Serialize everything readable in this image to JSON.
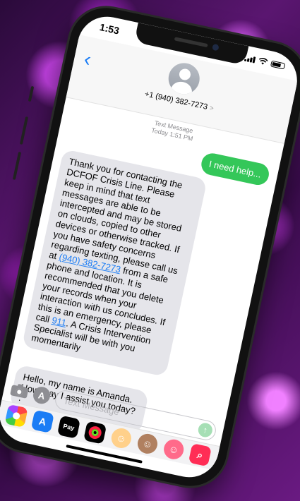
{
  "status_bar": {
    "time": "1:53"
  },
  "header": {
    "contact": "+1 (940) 382-7273",
    "chevron": ">"
  },
  "thread": {
    "label_line1": "Text Message",
    "label_line2": "Today 1:51 PM"
  },
  "messages": {
    "sent_1": "I need help...",
    "received_1": {
      "part1": "Thank you for contacting the DCFOF Crisis Line. Please keep in mind that text messages are able to be intercepted and may be stored on clouds, copied to other devices or otherwise tracked. If you have safety concerns regarding texting, please call us at ",
      "phone_link": "(940) 382-7273",
      "part2": " from a safe phone and location. It is recommended that you delete your records when your interaction with us concludes. If this is an emergency, please call ",
      "emergency_link": "911",
      "part3": ". A Crisis Intervention Specialist will be with you momentarily"
    },
    "received_2": "Hello, my name is Amanda. How may I assist you today?",
    "received_2_trailing": "."
  },
  "input": {
    "placeholder": "Text Message",
    "send_glyph": "↑",
    "appstore_glyph": "A"
  },
  "app_drawer": {
    "applepay_label": "Pay",
    "appstore_glyph": "A"
  },
  "colors": {
    "sent_bubble": "#34c759",
    "received_bubble": "#e5e5ea",
    "link": "#1a7cf5",
    "background_accent": "#b030d0"
  }
}
